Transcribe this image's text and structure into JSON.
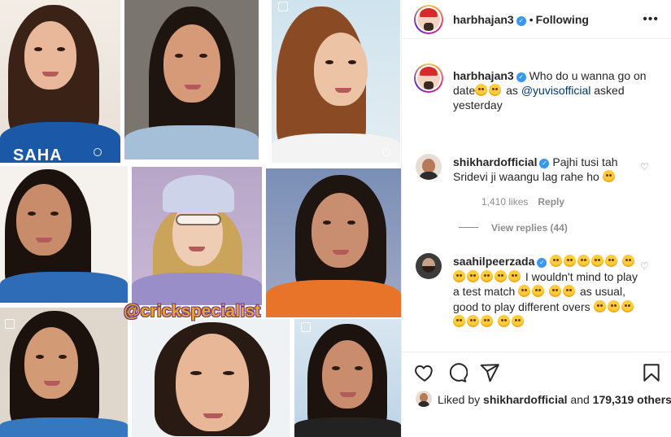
{
  "collage": {
    "watermark": "@crickspecialist",
    "jersey_text": "SAHA"
  },
  "header": {
    "username": "harbhajan3",
    "separator": "•",
    "follow_status": "Following",
    "more_icon": "more-horizontal-icon"
  },
  "caption": {
    "username": "harbhajan3",
    "text_before": "Who do u wanna go on date",
    "text_middle": " as ",
    "mention": "@yuvisofficial",
    "text_after": " asked yesterday"
  },
  "comments": [
    {
      "username": "shikhardofficial",
      "text": "Pajhi tusi tah Sridevi ji waangu lag rahe ho",
      "likes": "1,410 likes",
      "reply_label": "Reply",
      "view_replies": "View replies (44)"
    },
    {
      "username": "saahilpeerzada",
      "text_a": "I wouldn't mind to play a test match",
      "text_b": "as usual, good to play different overs"
    }
  ],
  "actions": {
    "like_icon": "heart-icon",
    "comment_icon": "comment-icon",
    "share_icon": "share-icon",
    "save_icon": "bookmark-icon"
  },
  "liked_by": {
    "prefix": "Liked by ",
    "user": "shikhardofficial",
    "middle": " and ",
    "count": "179,319 others"
  },
  "colors": {
    "verified_blue": "#3897f0",
    "mention_blue": "#00376b",
    "watermark_orange": "#f0a12a",
    "muted_gray": "#8e8e8e"
  }
}
